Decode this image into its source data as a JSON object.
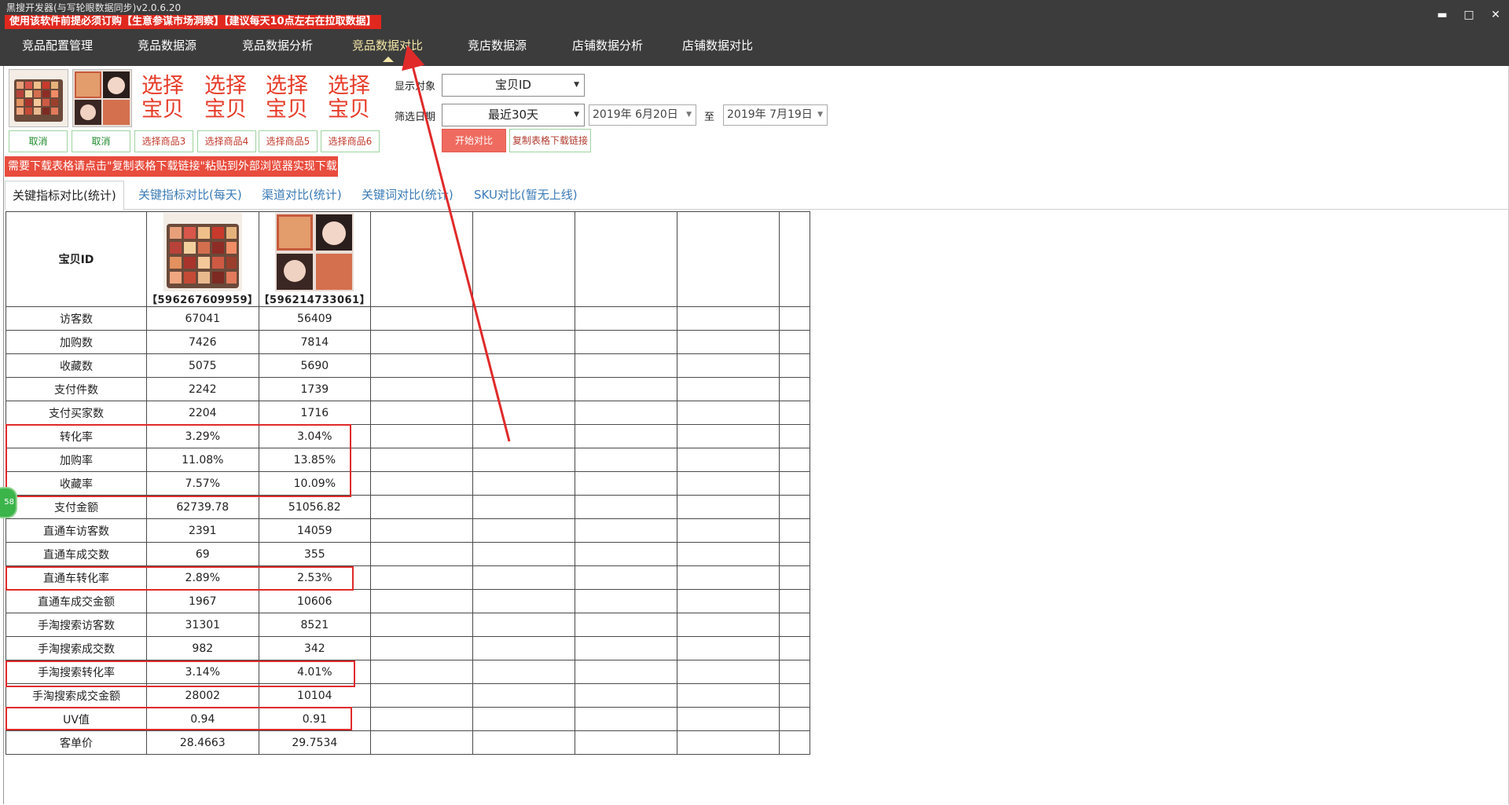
{
  "window": {
    "title": "黑搜开发器(与写轮眼数据同步)v2.0.6.20",
    "notice": "使用该软件前提必须订购【生意参谋市场洞察】【建议每天10点左右在拉取数据】",
    "controls": {
      "minimize": "▬",
      "maximize": "□",
      "close": "✕"
    }
  },
  "nav": {
    "items": [
      "竞品配置管理",
      "竞品数据源",
      "竞品数据分析",
      "竞品数据对比",
      "竞店数据源",
      "店铺数据分析",
      "店铺数据对比"
    ],
    "active": "竞品数据对比"
  },
  "selector": {
    "pick_labels": [
      "选择\n宝贝",
      "选择\n宝贝",
      "选择\n宝贝",
      "选择\n宝贝"
    ],
    "buttons": [
      "取消",
      "取消",
      "选择商品3",
      "选择商品4",
      "选择商品5",
      "选择商品6"
    ],
    "warning": "需要下载表格请点击\"复制表格下载链接\"粘贴到外部浏览器实现下载"
  },
  "filters": {
    "display_label": "显示对象",
    "display_value": "宝贝ID",
    "date_label": "筛选日期",
    "range_value": "最近30天",
    "date_from": "2019年  6月20日",
    "date_sep": "至",
    "date_to": "2019年  7月19日",
    "start_btn": "开始对比",
    "copy_btn": "复制表格下载链接"
  },
  "subtabs": [
    "关键指标对比(统计)",
    "关键指标对比(每天)",
    "渠道对比(统计)",
    "关键词对比(统计)",
    "SKU对比(暂无上线)"
  ],
  "table": {
    "header_label": "宝贝ID",
    "product_ids": [
      "【596267609959】",
      "【596214733061】"
    ],
    "rows": [
      {
        "metric": "访客数",
        "v1": "67041",
        "v2": "56409"
      },
      {
        "metric": "加购数",
        "v1": "7426",
        "v2": "7814"
      },
      {
        "metric": "收藏数",
        "v1": "5075",
        "v2": "5690"
      },
      {
        "metric": "支付件数",
        "v1": "2242",
        "v2": "1739"
      },
      {
        "metric": "支付买家数",
        "v1": "2204",
        "v2": "1716"
      },
      {
        "metric": "转化率",
        "v1": "3.29%",
        "v2": "3.04%"
      },
      {
        "metric": "加购率",
        "v1": "11.08%",
        "v2": "13.85%"
      },
      {
        "metric": "收藏率",
        "v1": "7.57%",
        "v2": "10.09%"
      },
      {
        "metric": "支付金额",
        "v1": "62739.78",
        "v2": "51056.82"
      },
      {
        "metric": "直通车访客数",
        "v1": "2391",
        "v2": "14059"
      },
      {
        "metric": "直通车成交数",
        "v1": "69",
        "v2": "355"
      },
      {
        "metric": "直通车转化率",
        "v1": "2.89%",
        "v2": "2.53%"
      },
      {
        "metric": "直通车成交金额",
        "v1": "1967",
        "v2": "10606"
      },
      {
        "metric": "手淘搜索访客数",
        "v1": "31301",
        "v2": "8521"
      },
      {
        "metric": "手淘搜索成交数",
        "v1": "982",
        "v2": "342"
      },
      {
        "metric": "手淘搜索转化率",
        "v1": "3.14%",
        "v2": "4.01%"
      },
      {
        "metric": "手淘搜索成交金额",
        "v1": "28002",
        "v2": "10104"
      },
      {
        "metric": "UV值",
        "v1": "0.94",
        "v2": "0.91"
      },
      {
        "metric": "客单价",
        "v1": "28.4663",
        "v2": "29.7534"
      }
    ]
  },
  "colors": {
    "accent_red": "#e0281e",
    "nav_bg": "#3c3c3c",
    "active_tab": "#f3e6a6",
    "link_blue": "#3b7bb6"
  }
}
